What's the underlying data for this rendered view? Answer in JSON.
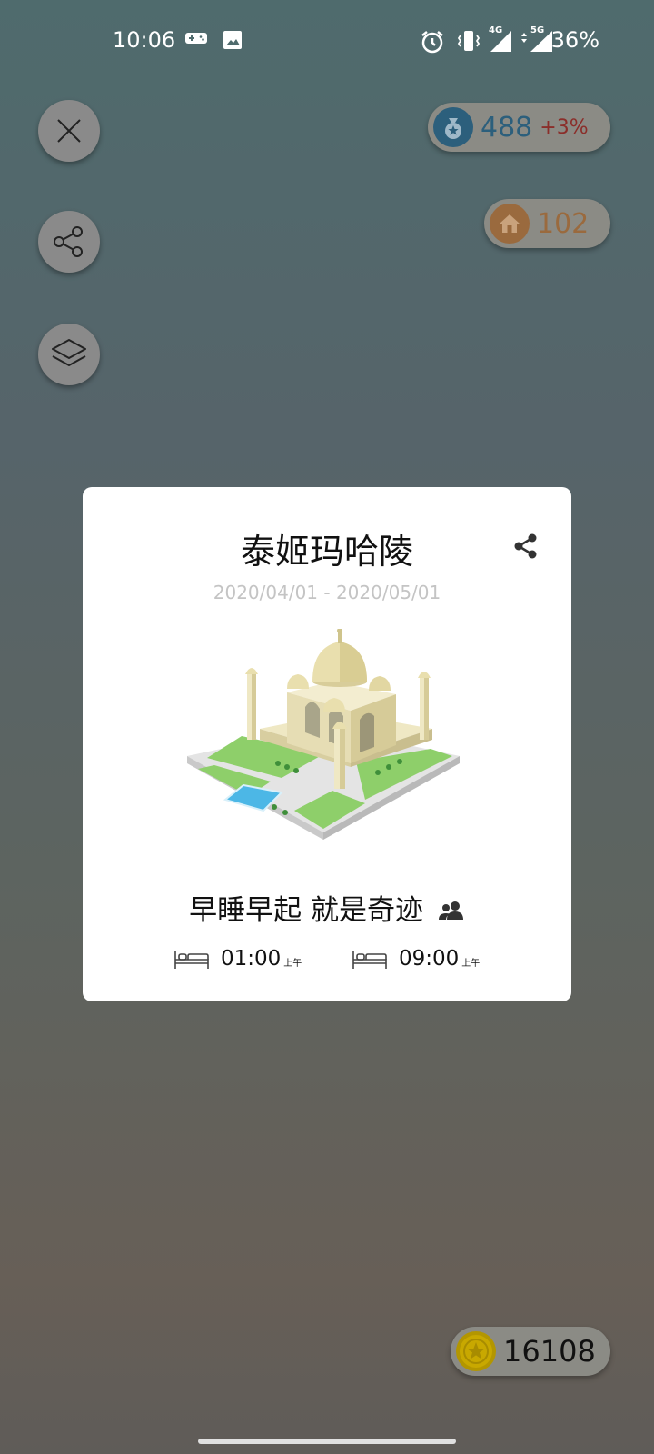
{
  "status_bar": {
    "time": "10:06",
    "battery": "36%",
    "net_4g": "4G",
    "net_5g": "5G",
    "icons": [
      "gamepad-icon",
      "image-icon",
      "alarm-icon",
      "vibrate-icon",
      "signal-4g-icon",
      "signal-5g-icon"
    ]
  },
  "left_buttons": [
    "close-icon",
    "share-icon",
    "layers-icon"
  ],
  "stats": {
    "money_value": "488",
    "money_delta": "+3%",
    "houses_value": "102",
    "coins_value": "16108"
  },
  "card": {
    "title": "泰姬玛哈陵",
    "date_range": "2020/04/01 - 2020/05/01",
    "slogan": "早睡早起 就是奇迹",
    "sleep_time": "01:00",
    "sleep_suffix": "上午",
    "wake_time": "09:00",
    "wake_suffix": "上午"
  },
  "colors": {
    "money_accent": "#2c5f7c",
    "delta_red": "#8b2e2a",
    "house_accent": "#9a6a3e",
    "coin_gold": "#c8a800"
  }
}
